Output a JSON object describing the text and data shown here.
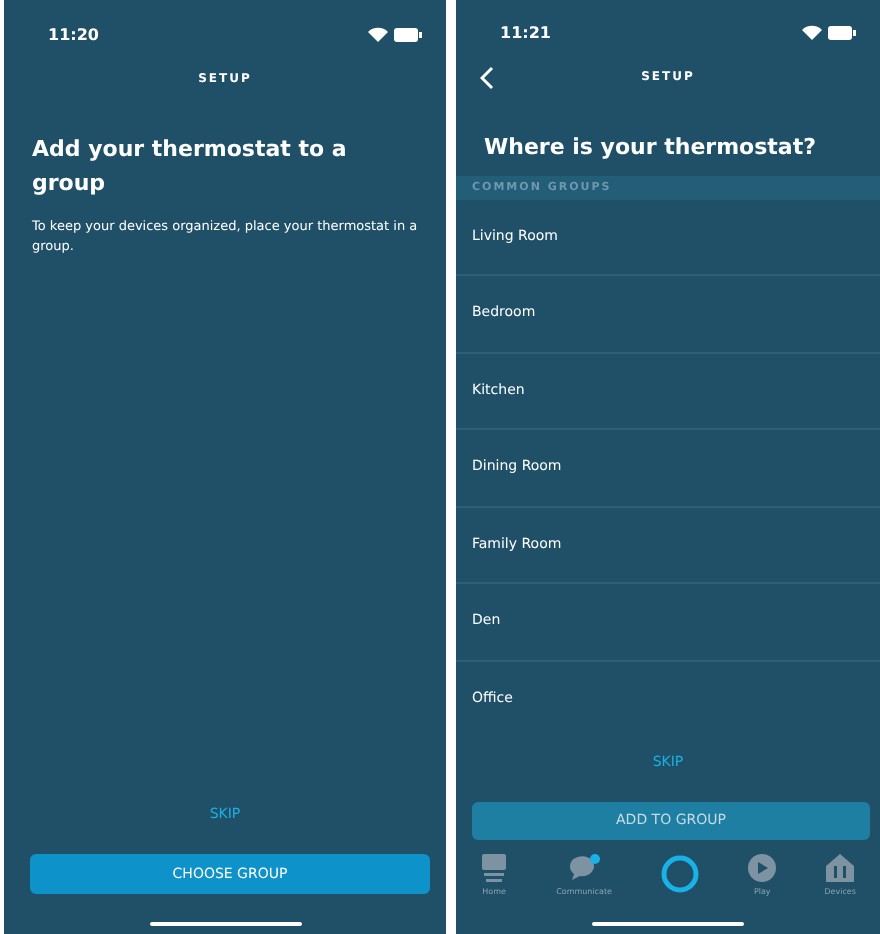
{
  "screens": [
    {
      "time": "11:20",
      "back": false,
      "header": "SETUP",
      "title": "Add your thermostat to a group",
      "description": "To keep your devices organized, place your thermostat in a group.",
      "skip": "SKIP",
      "button": {
        "label": "CHOOSE GROUP",
        "disabled": false
      }
    },
    {
      "time": "11:21",
      "back": true,
      "header": "SETUP",
      "title": "Where is your thermostat?",
      "section": "COMMON GROUPS",
      "groups": [
        "Living Room",
        "Bedroom",
        "Kitchen",
        "Dining Room",
        "Family Room",
        "Den",
        "Office"
      ],
      "skip": "SKIP",
      "button": {
        "label": "ADD TO GROUP",
        "disabled": true
      },
      "tabs": [
        {
          "kind": "home",
          "label": "Home"
        },
        {
          "kind": "communicate",
          "label": "Communicate"
        },
        {
          "kind": "alexa"
        },
        {
          "kind": "play",
          "label": "Play"
        },
        {
          "kind": "devices",
          "label": "Devices"
        }
      ]
    }
  ]
}
